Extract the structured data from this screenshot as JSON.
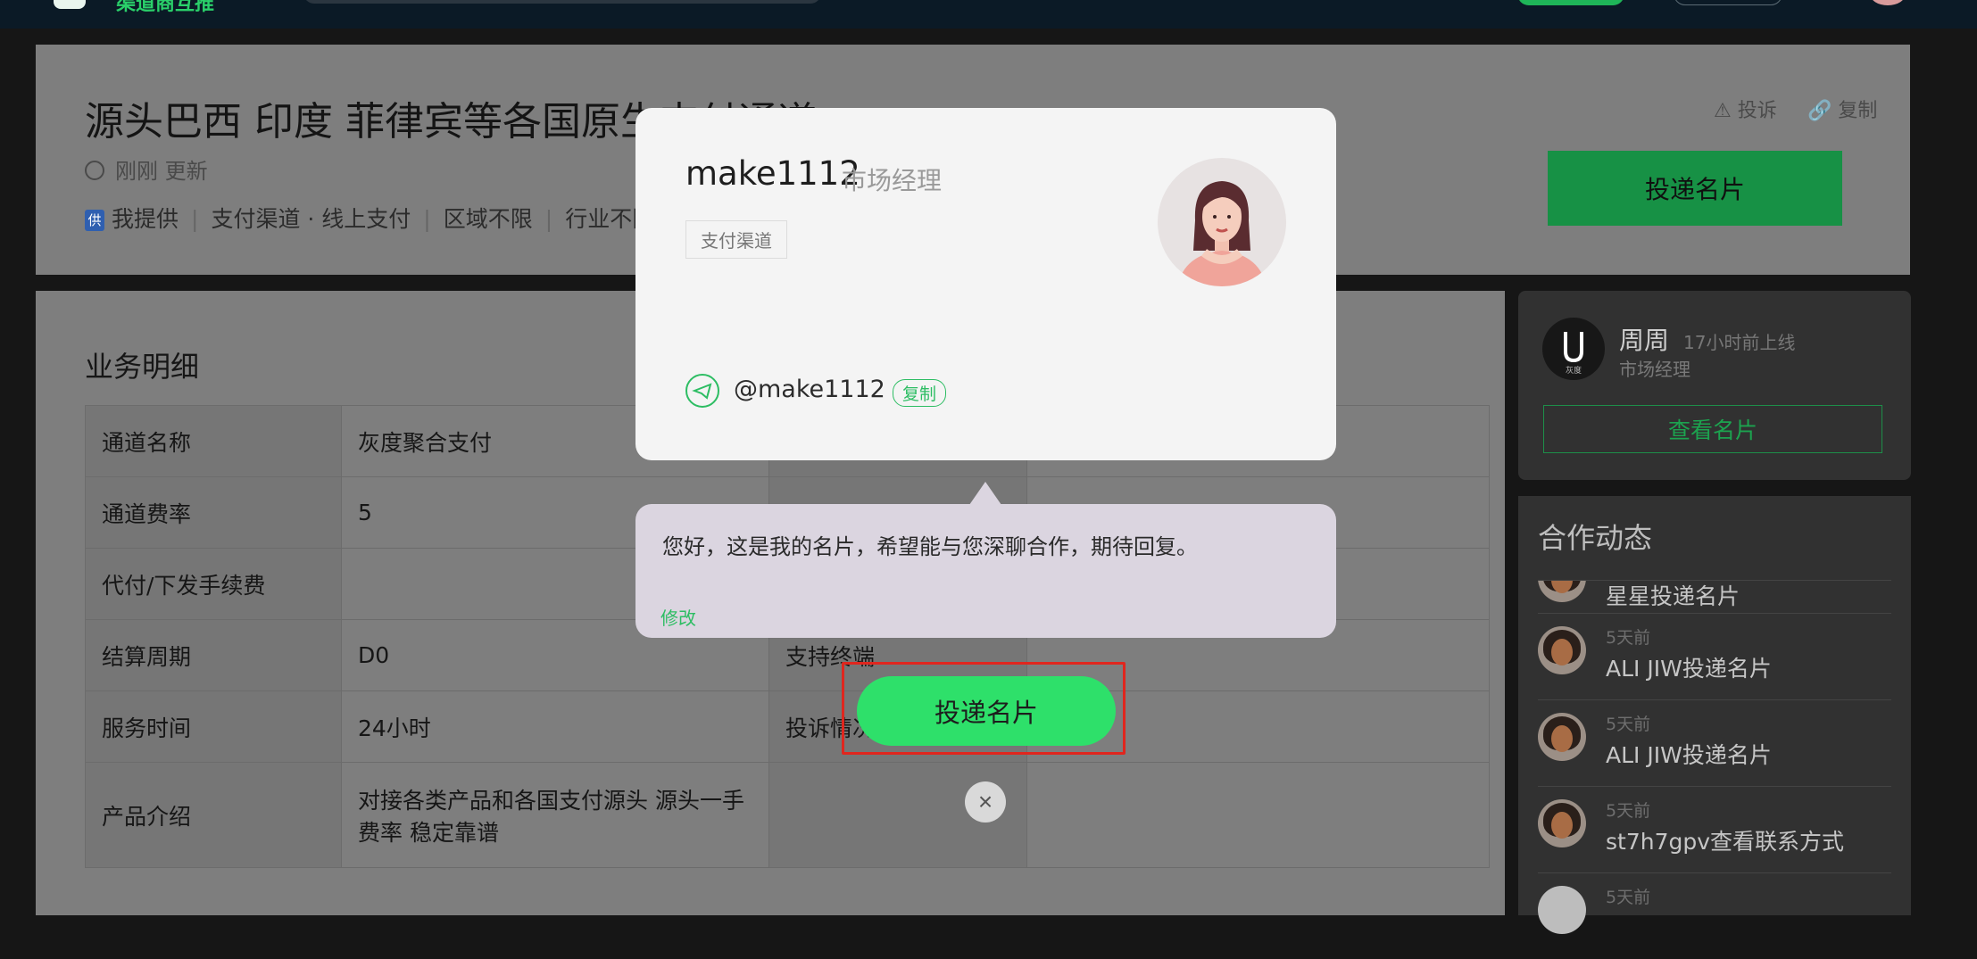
{
  "topbar": {
    "logo_text": "渠道商互推"
  },
  "header": {
    "title": "源头巴西 印度 菲律宾等各国原生支付通道",
    "updated": "刚刚 更新",
    "tag_badge": "供",
    "tags": [
      "我提供",
      "支付渠道 · 线上支付",
      "区域不限",
      "行业不限"
    ],
    "report_label": "投诉",
    "copy_label": "复制",
    "deliver_label": "投递名片"
  },
  "detail": {
    "section_title": "业务明细",
    "rows": [
      {
        "label": "通道名称",
        "value": "灰度聚合支付",
        "label2": "",
        "value2": ""
      },
      {
        "label": "通道费率",
        "value": "5",
        "label2": "",
        "value2": ""
      },
      {
        "label": "代付/下发手续费",
        "value": "",
        "label2": "",
        "value2": ""
      },
      {
        "label": "结算周期",
        "value": "D0",
        "label2": "支持终端",
        "value2": ""
      },
      {
        "label": "服务时间",
        "value": "24小时",
        "label2": "投诉情况",
        "value2": ""
      },
      {
        "label": "产品介绍",
        "value": "对接各类产品和各国支付源头 源头一手费率 稳定靠谱",
        "label2": "",
        "value2": ""
      }
    ]
  },
  "profile": {
    "logo_text": "灰度",
    "name": "周周",
    "online": "17小时前上线",
    "role": "市场经理",
    "view_label": "查看名片"
  },
  "activity": {
    "title": "合作动态",
    "items": [
      {
        "time": "",
        "text": "星星投递名片"
      },
      {
        "time": "5天前",
        "text": "ALI JIW投递名片"
      },
      {
        "time": "5天前",
        "text": "ALI JIW投递名片"
      },
      {
        "time": "5天前",
        "text": "st7h7gpv查看联系方式"
      },
      {
        "time": "5天前",
        "text": ""
      }
    ]
  },
  "modal": {
    "username": "make1112",
    "role": "市场经理",
    "tag": "支付渠道",
    "telegram_handle": "@make1112",
    "copy_label": "复制",
    "message": "您好，这是我的名片，希望能与您深聊合作，期待回复。",
    "edit_label": "修改",
    "send_label": "投递名片",
    "close_glyph": "×"
  },
  "colors": {
    "accent": "#2ee06a",
    "highlight": "#e0261e"
  }
}
